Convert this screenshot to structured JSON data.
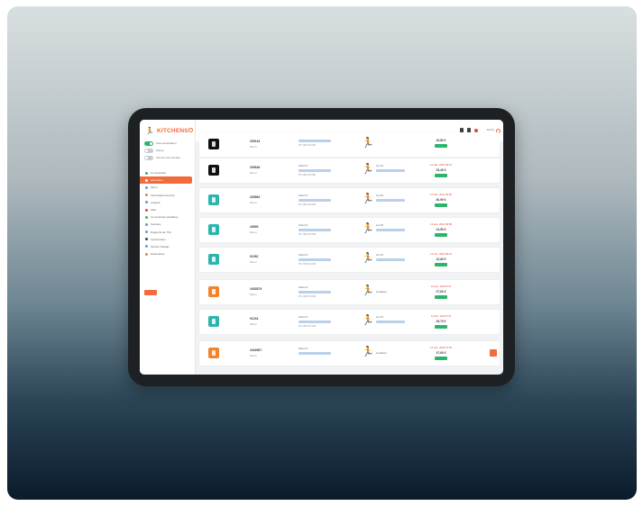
{
  "app": {
    "logo_text": "KITCHENS",
    "accent_color": "#f26b3a",
    "success_color": "#2db46b"
  },
  "sidebar": {
    "toggles": [
      {
        "label": "Auto-acceptation",
        "on": true
      },
      {
        "label": "Pause",
        "on": false
      },
      {
        "label": "Vendre commandes",
        "on": false
      }
    ],
    "items": [
      {
        "label": "Commandes",
        "color": "#2db46b",
        "active": false
      },
      {
        "label": "Historique",
        "color": "#ffffff",
        "active": true
      },
      {
        "label": "Menu",
        "color": "#5b9bd5",
        "active": false
      },
      {
        "label": "Ventes/Evenements",
        "color": "#f3832a",
        "active": false
      },
      {
        "label": "Analyse",
        "color": "#5b9bd5",
        "active": false
      },
      {
        "label": "Aide",
        "color": "#e0473b",
        "active": false
      },
      {
        "label": "Commandes planifiées",
        "color": "#2db46b",
        "active": false
      },
      {
        "label": "Factures",
        "color": "#5b9bd5",
        "active": false
      },
      {
        "label": "Rapports de TVA",
        "color": "#5b9bd5",
        "active": false
      },
      {
        "label": "Imprimantes",
        "color": "#3c4048",
        "active": false
      },
      {
        "label": "Kitchen Display",
        "color": "#5b9bd5",
        "active": false
      },
      {
        "label": "Paramètres",
        "color": "#f3832a",
        "active": false
      }
    ]
  },
  "topbar": {
    "user_label": "Admin"
  },
  "orders": [
    {
      "platform": "ubereats",
      "id": "295143",
      "sub": "Menu",
      "customer": "",
      "phone": "Ph: 060 00 000",
      "rider_icon": "green",
      "rider": "",
      "rider_status": "",
      "time": "",
      "amount": "16,80 €"
    },
    {
      "platform": "ubereats",
      "id": "305648",
      "sub": "Menu",
      "customer": "Client X",
      "phone": "Ph: 060 00 000",
      "rider_icon": "green",
      "rider": "Livr B",
      "rider_status": "",
      "time": "12 déc. 2022 09:13",
      "amount": "23,40 €"
    },
    {
      "platform": "deliveroo",
      "id": "328563",
      "sub": "Menu",
      "customer": "Client X",
      "phone": "Ph: 060 00 000",
      "rider_icon": "green",
      "rider": "Livr B",
      "rider_status": "",
      "time": "12 déc. 2022 09:05",
      "amount": "40,90 €"
    },
    {
      "platform": "deliveroo",
      "id": "40699",
      "sub": "Menu",
      "customer": "Client X",
      "phone": "Ph: 060 00 000",
      "rider_icon": "green",
      "rider": "Livr B",
      "rider_status": "",
      "time": "12 déc. 2022 08:58",
      "amount": "14,50 €"
    },
    {
      "platform": "deliveroo",
      "id": "91052",
      "sub": "Menu",
      "customer": "Client X",
      "phone": "Ph: 060 00 000",
      "rider_icon": "green",
      "rider": "Livr B",
      "rider_status": "",
      "time": "12 déc. 2022 08:44",
      "amount": "12,60 €"
    },
    {
      "platform": "justeat",
      "id": "3452879",
      "sub": "Menu",
      "customer": "Client X",
      "phone": "Ph: 060 00 000",
      "rider_icon": "orange",
      "rider": "",
      "rider_status": "Livraison",
      "time": "12 déc. 2022 8:21",
      "amount": "27,60 €"
    },
    {
      "platform": "deliveroo",
      "id": "91244",
      "sub": "Menu",
      "customer": "Client X",
      "phone": "Ph: 060 00 000",
      "rider_icon": "green",
      "rider": "Livr B",
      "rider_status": "",
      "time": "12 déc. 2022 8:07",
      "amount": "25,70 €"
    },
    {
      "platform": "justeat",
      "id": "3434567",
      "sub": "Menu",
      "customer": "Client X",
      "phone": "",
      "rider_icon": "orange",
      "rider": "",
      "rider_status": "Livraison",
      "time": "12 déc. 2022 07:45",
      "amount": "37,60 €"
    }
  ]
}
